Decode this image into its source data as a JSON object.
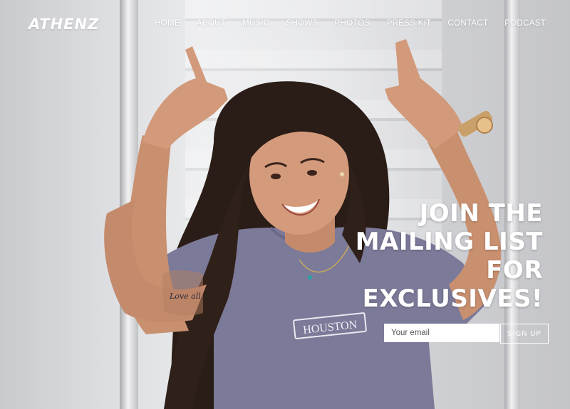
{
  "brand": {
    "logo_text": "ATHENZ"
  },
  "nav": {
    "items": [
      "HOME",
      "ABOUT",
      "MUSIC",
      "SHOWS",
      "PHOTOS",
      "PRESS KIT",
      "CONTACT",
      "PODCAST"
    ]
  },
  "hero": {
    "headline_lines": [
      "JOIN THE",
      "MAILING LIST",
      "FOR",
      "EXCLUSIVES!"
    ],
    "shirt_text": "HOUSTON",
    "tattoo_text": "Love all,"
  },
  "signup": {
    "email_placeholder": "Your email",
    "button_label": "SIGN UP"
  }
}
